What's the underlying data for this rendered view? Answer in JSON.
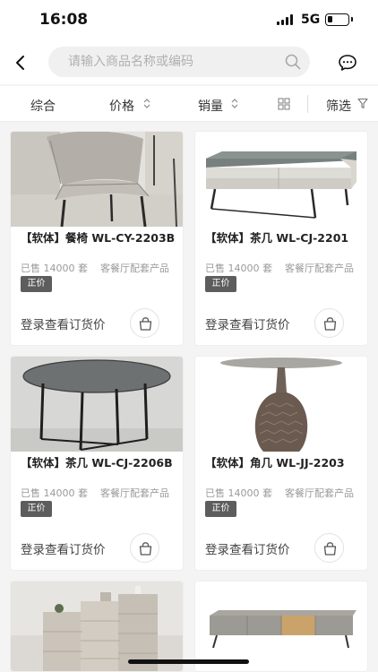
{
  "status_bar": {
    "time": "16:08",
    "network": "5G"
  },
  "search": {
    "placeholder": "请输入商品名称或编码"
  },
  "filters": {
    "comprehensive": "综合",
    "price": "价格",
    "sales": "销量",
    "filter": "筛选"
  },
  "products": [
    {
      "title": "【软体】餐椅 WL-CY-2203B",
      "sold": "已售 14000 套",
      "category": "客餐厅配套产品",
      "badge": "正价",
      "login_text": "登录查看订货价"
    },
    {
      "title": "【软体】茶几 WL-CJ-2201",
      "sold": "已售 14000 套",
      "category": "客餐厅配套产品",
      "badge": "正价",
      "login_text": "登录查看订货价"
    },
    {
      "title": "【软体】茶几 WL-CJ-2206B",
      "sold": "已售 14000 套",
      "category": "客餐厅配套产品",
      "badge": "正价",
      "login_text": "登录查看订货价"
    },
    {
      "title": "【软体】角几 WL-JJ-2203",
      "sold": "已售 14000 套",
      "category": "客餐厅配套产品",
      "badge": "正价",
      "login_text": "登录查看订货价"
    }
  ],
  "icons": {
    "back": "back-arrow-icon",
    "search": "search-icon",
    "chat": "chat-icon",
    "sort": "sort-arrows-icon",
    "grid": "grid-view-icon",
    "filter": "funnel-icon",
    "cart": "shopping-bag-icon"
  },
  "colors": {
    "badge_bg": "#5d5d5d",
    "page_bg": "#f4f4f4"
  }
}
